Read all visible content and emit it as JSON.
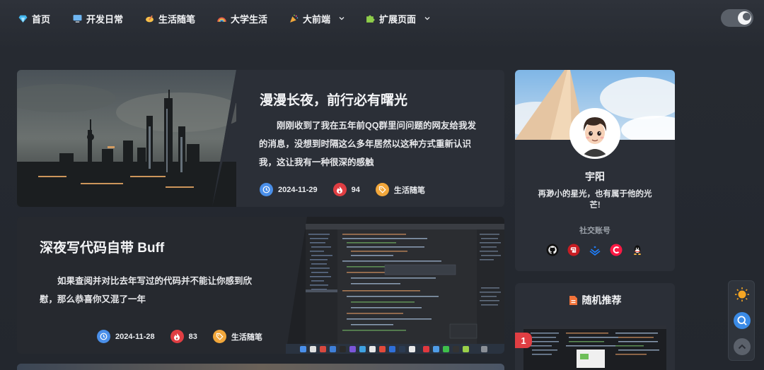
{
  "nav": {
    "items": [
      {
        "label": "首页",
        "icon": "gem-icon",
        "has_dropdown": false
      },
      {
        "label": "开发日常",
        "icon": "monitor-icon",
        "has_dropdown": false
      },
      {
        "label": "生活随笔",
        "icon": "writing-hand-icon",
        "has_dropdown": false
      },
      {
        "label": "大学生活",
        "icon": "rainbow-icon",
        "has_dropdown": false
      },
      {
        "label": "大前端",
        "icon": "party-popper-icon",
        "has_dropdown": true
      },
      {
        "label": "扩展页面",
        "icon": "puzzle-icon",
        "has_dropdown": true
      }
    ],
    "theme_toggle": "dark"
  },
  "posts": [
    {
      "title": "漫漫长夜，前行必有曙光",
      "excerpt": "刚刚收到了我在五年前QQ群里问问题的网友给我发的消息，没想到时隔这么多年居然以这种方式重新认识我，这让我有一种很深的感触",
      "date": "2024-11-29",
      "views": "94",
      "category": "生活随笔"
    },
    {
      "title": "深夜写代码自带 Buff",
      "excerpt": "如果查阅并对比去年写过的代码并不能让你感到欣慰，那么恭喜你又混了一年",
      "date": "2024-11-28",
      "views": "83",
      "category": "生活随笔"
    }
  ],
  "profile": {
    "name": "宇阳",
    "motto": "再渺小的星光，也有属于他的光芒!",
    "social_title": "社交账号",
    "social": [
      "github-icon",
      "gitee-icon",
      "juejin-icon",
      "csdn-icon",
      "qq-icon"
    ]
  },
  "recommend": {
    "title": "随机推荐",
    "badge": "1"
  },
  "colors": {
    "background": "#23272e",
    "card": "#2b2f37",
    "blue": "#4a8fe9",
    "red": "#e03e43",
    "orange": "#f2a73b"
  }
}
